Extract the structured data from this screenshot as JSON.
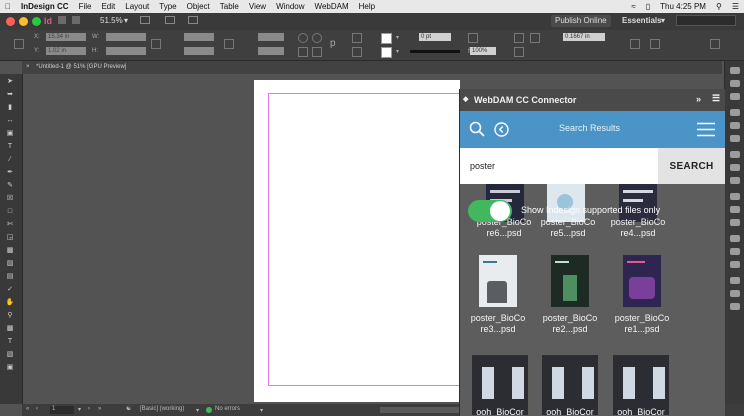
{
  "menubar": {
    "app_name": "InDesign CC",
    "items": [
      "File",
      "Edit",
      "Layout",
      "Type",
      "Object",
      "Table",
      "View",
      "Window",
      "WebDAM",
      "Help"
    ],
    "clock": "Thu 4:25 PM"
  },
  "appbar": {
    "zoom": "51.5%",
    "publish_label": "Publish Online",
    "workspace_label": "Essentials"
  },
  "controlbar": {
    "x_value": "15.34 in",
    "y_value": "1.02 in",
    "stroke_weight": "0 pt",
    "opacity": "100%",
    "gap_value": "0.1667 in"
  },
  "document": {
    "tab_title": "*Untitled-1 @ 51% [GPU Preview]"
  },
  "statusbar": {
    "page_number": "1",
    "style": "[Basic] (working)",
    "errors": "No errors"
  },
  "panel": {
    "title": "WebDAM CC Connector",
    "header_title": "Search Results",
    "search_value": "poster",
    "search_button": "SEARCH",
    "toggle_label": "Show Indesign supported files only",
    "toggle_on": true,
    "results": [
      {
        "line1": "poster_BioCo",
        "line2": "re6...psd",
        "color": "#25273a"
      },
      {
        "line1": "poster_BioCo",
        "line2": "re5...psd",
        "color": "#dfe7ee"
      },
      {
        "line1": "poster_BioCo",
        "line2": "re4...psd",
        "color": "#2a2b3c"
      },
      {
        "line1": "poster_BioCo",
        "line2": "re3...psd",
        "color": "#e8ecef"
      },
      {
        "line1": "poster_BioCo",
        "line2": "re2...psd",
        "color": "#1e2a24"
      },
      {
        "line1": "poster_BioCo",
        "line2": "re1...psd",
        "color": "#2e2650"
      },
      {
        "line1": "ooh_BioCor",
        "line2": "",
        "color": "#2b2d33"
      },
      {
        "line1": "ooh_BioCor",
        "line2": "",
        "color": "#2b2d33"
      },
      {
        "line1": "ooh_BioCor",
        "line2": "",
        "color": "#2b2d33"
      }
    ]
  }
}
